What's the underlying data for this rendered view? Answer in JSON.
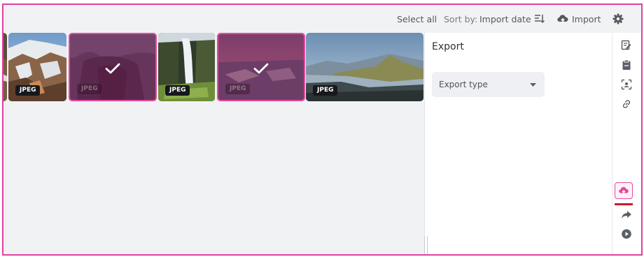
{
  "toolbar": {
    "select_all": "Select all",
    "sort_by_label": "Sort by:",
    "sort_by_value": "Import date",
    "import_label": "Import"
  },
  "thumbnails": [
    {
      "badge": "JPEG",
      "selected": false,
      "subject": "mountain-snow-slopes"
    },
    {
      "badge": "JPEG",
      "selected": true,
      "subject": "ice-cave"
    },
    {
      "badge": "JPEG",
      "selected": false,
      "subject": "waterfall"
    },
    {
      "badge": "JPEG",
      "selected": true,
      "subject": "glacier-lagoon-sunset"
    },
    {
      "badge": "JPEG",
      "selected": false,
      "subject": "highland-valley"
    }
  ],
  "panel": {
    "title": "Export",
    "export_type_placeholder": "Export type"
  },
  "rail": {
    "icons": [
      "edit-icon",
      "clipboard-icon",
      "face-scan-icon",
      "link-icon",
      "cloud-upload-icon",
      "share-icon",
      "play-icon"
    ],
    "active": "cloud-upload-icon"
  },
  "colors": {
    "accent": "#e5499c",
    "underline": "#d0172c",
    "frame": "#e040a0"
  }
}
